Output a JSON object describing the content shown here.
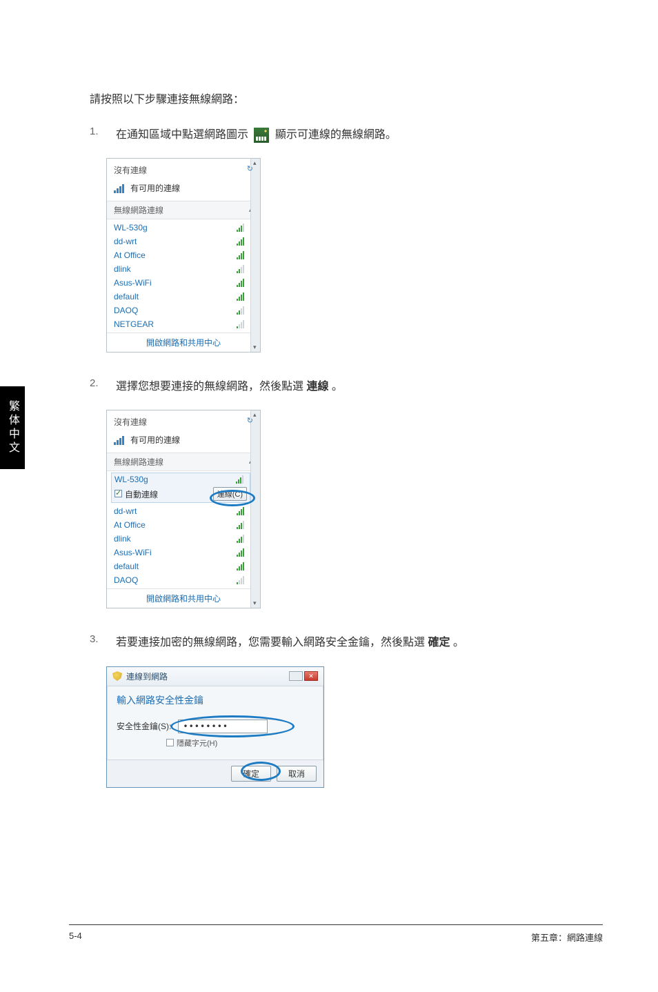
{
  "sideTab": "繁体中文",
  "heading": "請按照以下步驟連接無線網路：",
  "steps": {
    "s1": {
      "num": "1.",
      "before": "在通知區域中點選網路圖示",
      "after": "顯示可連線的無線網路。"
    },
    "s2": {
      "num": "2.",
      "text_a": "選擇您想要連接的無線網路，然後點選 ",
      "text_b": "連線",
      "text_c": " 。"
    },
    "s3": {
      "num": "3.",
      "text_a": "若要連接加密的無線網路，您需要輸入網路安全金鑰，然後點選 ",
      "text_b": "確定",
      "text_c": " 。"
    }
  },
  "panel1": {
    "noConn": "沒有連線",
    "avail": "有可用的連線",
    "sectionHdr": "無線網路連線",
    "chevUp": "▴",
    "items": [
      {
        "name": "WL-530g",
        "sig": "s3"
      },
      {
        "name": "dd-wrt",
        "sig": "s4"
      },
      {
        "name": "At Office",
        "sig": "s4"
      },
      {
        "name": "dlink",
        "sig": "s2"
      },
      {
        "name": "Asus-WiFi",
        "sig": "s4"
      },
      {
        "name": "default",
        "sig": "s4"
      },
      {
        "name": "DAOQ",
        "sig": "s2"
      },
      {
        "name": "NETGEAR",
        "sig": "s1"
      }
    ],
    "footer": "開啟網路和共用中心"
  },
  "panel2": {
    "noConn": "沒有連線",
    "avail": "有可用的連線",
    "sectionHdr": "無線網路連線",
    "chevUp": "▴",
    "selected": {
      "name": "WL-530g",
      "auto": "自動連線",
      "connect": "連線(C)"
    },
    "items": [
      {
        "name": "dd-wrt",
        "sig": "s4"
      },
      {
        "name": "At Office",
        "sig": "s3"
      },
      {
        "name": "dlink",
        "sig": "s3"
      },
      {
        "name": "Asus-WiFi",
        "sig": "s4"
      },
      {
        "name": "default",
        "sig": "s4"
      },
      {
        "name": "DAOQ",
        "sig": "s1"
      }
    ],
    "footer": "開啟網路和共用中心"
  },
  "dialog": {
    "title": "連線到網路",
    "heading": "輸入網路安全性金鑰",
    "label": "安全性金鑰(S):",
    "value": "••••••••",
    "hide": "隱藏字元(H)",
    "ok": "確定",
    "cancel": "取消"
  },
  "footer": {
    "left": "5-4",
    "right": "第五章：網路連線"
  }
}
